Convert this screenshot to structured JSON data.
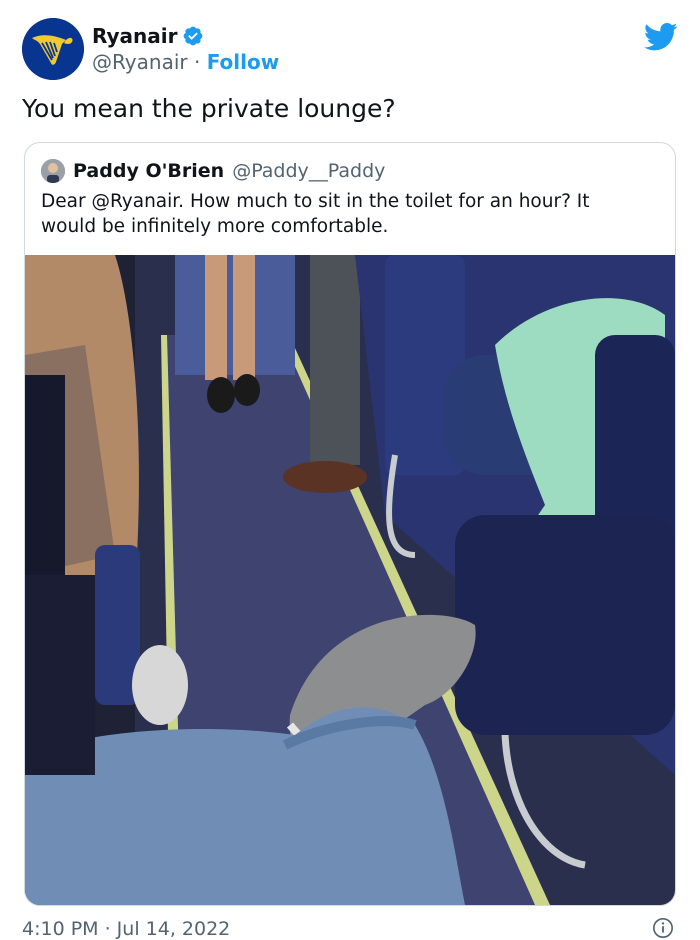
{
  "tweet": {
    "author": {
      "display_name": "Ryanair",
      "handle": "@Ryanair",
      "separator": "·",
      "follow_label": "Follow",
      "verified": true
    },
    "text": "You mean the private lounge?",
    "timestamp": "4:10 PM · Jul 14, 2022"
  },
  "quote": {
    "display_name": "Paddy O'Brien",
    "handle": "@Paddy__Paddy",
    "text": "Dear @Ryanair. How much to sit in the toilet for an hour? It would be infinitely more comfortable."
  },
  "colors": {
    "brand_blue": "#1d9bf0",
    "ryanair_navy": "#073590",
    "ryanair_gold": "#f1c933"
  },
  "icons": [
    "verified-badge-icon",
    "twitter-bird-icon",
    "info-icon"
  ]
}
